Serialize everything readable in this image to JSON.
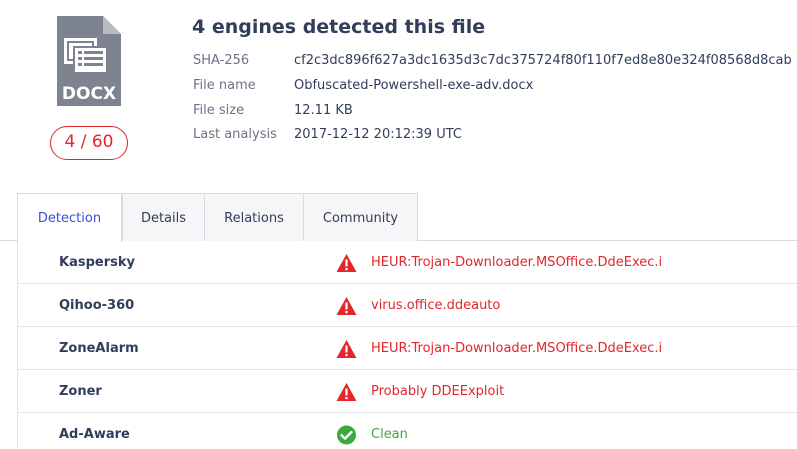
{
  "file": {
    "type_label": "DOCX",
    "score": "4 / 60",
    "headline": "4 engines detected this file"
  },
  "details": [
    {
      "key": "SHA-256",
      "value": "cf2c3dc896f627a3dc1635d3c7dc375724f80f110f7ed8e80e324f08568d8cab"
    },
    {
      "key": "File name",
      "value": "Obfuscated-Powershell-exe-adv.docx"
    },
    {
      "key": "File size",
      "value": "12.11 KB"
    },
    {
      "key": "Last analysis",
      "value": "2017-12-12 20:12:39 UTC"
    }
  ],
  "tabs": [
    {
      "label": "Detection",
      "active": true
    },
    {
      "label": "Details",
      "active": false
    },
    {
      "label": "Relations",
      "active": false
    },
    {
      "label": "Community",
      "active": false
    }
  ],
  "results": [
    {
      "engine": "Kaspersky",
      "verdict": "HEUR:Trojan-Downloader.MSOffice.DdeExec.i",
      "status": "malicious",
      "icon": "warning-icon"
    },
    {
      "engine": "Qihoo-360",
      "verdict": "virus.office.ddeauto",
      "status": "malicious",
      "icon": "warning-icon"
    },
    {
      "engine": "ZoneAlarm",
      "verdict": "HEUR:Trojan-Downloader.MSOffice.DdeExec.i",
      "status": "malicious",
      "icon": "warning-icon"
    },
    {
      "engine": "Zoner",
      "verdict": "Probably DDEExploit",
      "status": "malicious",
      "icon": "warning-icon"
    },
    {
      "engine": "Ad-Aware",
      "verdict": "Clean",
      "status": "clean",
      "icon": "check-circle-icon"
    }
  ],
  "colors": {
    "malicious": "#e2262a",
    "clean": "#3ea93b",
    "accent": "#3b4ce0",
    "icon_gray": "#7e8390"
  }
}
